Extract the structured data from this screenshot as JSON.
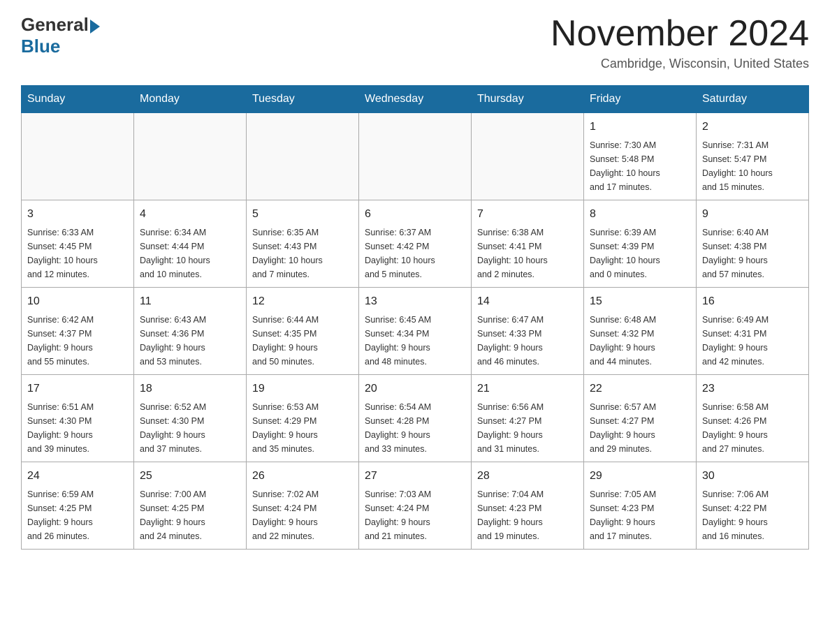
{
  "header": {
    "logo_general": "General",
    "logo_blue": "Blue",
    "title": "November 2024",
    "location": "Cambridge, Wisconsin, United States"
  },
  "days_of_week": [
    "Sunday",
    "Monday",
    "Tuesday",
    "Wednesday",
    "Thursday",
    "Friday",
    "Saturday"
  ],
  "weeks": [
    [
      {
        "day": "",
        "info": ""
      },
      {
        "day": "",
        "info": ""
      },
      {
        "day": "",
        "info": ""
      },
      {
        "day": "",
        "info": ""
      },
      {
        "day": "",
        "info": ""
      },
      {
        "day": "1",
        "info": "Sunrise: 7:30 AM\nSunset: 5:48 PM\nDaylight: 10 hours\nand 17 minutes."
      },
      {
        "day": "2",
        "info": "Sunrise: 7:31 AM\nSunset: 5:47 PM\nDaylight: 10 hours\nand 15 minutes."
      }
    ],
    [
      {
        "day": "3",
        "info": "Sunrise: 6:33 AM\nSunset: 4:45 PM\nDaylight: 10 hours\nand 12 minutes."
      },
      {
        "day": "4",
        "info": "Sunrise: 6:34 AM\nSunset: 4:44 PM\nDaylight: 10 hours\nand 10 minutes."
      },
      {
        "day": "5",
        "info": "Sunrise: 6:35 AM\nSunset: 4:43 PM\nDaylight: 10 hours\nand 7 minutes."
      },
      {
        "day": "6",
        "info": "Sunrise: 6:37 AM\nSunset: 4:42 PM\nDaylight: 10 hours\nand 5 minutes."
      },
      {
        "day": "7",
        "info": "Sunrise: 6:38 AM\nSunset: 4:41 PM\nDaylight: 10 hours\nand 2 minutes."
      },
      {
        "day": "8",
        "info": "Sunrise: 6:39 AM\nSunset: 4:39 PM\nDaylight: 10 hours\nand 0 minutes."
      },
      {
        "day": "9",
        "info": "Sunrise: 6:40 AM\nSunset: 4:38 PM\nDaylight: 9 hours\nand 57 minutes."
      }
    ],
    [
      {
        "day": "10",
        "info": "Sunrise: 6:42 AM\nSunset: 4:37 PM\nDaylight: 9 hours\nand 55 minutes."
      },
      {
        "day": "11",
        "info": "Sunrise: 6:43 AM\nSunset: 4:36 PM\nDaylight: 9 hours\nand 53 minutes."
      },
      {
        "day": "12",
        "info": "Sunrise: 6:44 AM\nSunset: 4:35 PM\nDaylight: 9 hours\nand 50 minutes."
      },
      {
        "day": "13",
        "info": "Sunrise: 6:45 AM\nSunset: 4:34 PM\nDaylight: 9 hours\nand 48 minutes."
      },
      {
        "day": "14",
        "info": "Sunrise: 6:47 AM\nSunset: 4:33 PM\nDaylight: 9 hours\nand 46 minutes."
      },
      {
        "day": "15",
        "info": "Sunrise: 6:48 AM\nSunset: 4:32 PM\nDaylight: 9 hours\nand 44 minutes."
      },
      {
        "day": "16",
        "info": "Sunrise: 6:49 AM\nSunset: 4:31 PM\nDaylight: 9 hours\nand 42 minutes."
      }
    ],
    [
      {
        "day": "17",
        "info": "Sunrise: 6:51 AM\nSunset: 4:30 PM\nDaylight: 9 hours\nand 39 minutes."
      },
      {
        "day": "18",
        "info": "Sunrise: 6:52 AM\nSunset: 4:30 PM\nDaylight: 9 hours\nand 37 minutes."
      },
      {
        "day": "19",
        "info": "Sunrise: 6:53 AM\nSunset: 4:29 PM\nDaylight: 9 hours\nand 35 minutes."
      },
      {
        "day": "20",
        "info": "Sunrise: 6:54 AM\nSunset: 4:28 PM\nDaylight: 9 hours\nand 33 minutes."
      },
      {
        "day": "21",
        "info": "Sunrise: 6:56 AM\nSunset: 4:27 PM\nDaylight: 9 hours\nand 31 minutes."
      },
      {
        "day": "22",
        "info": "Sunrise: 6:57 AM\nSunset: 4:27 PM\nDaylight: 9 hours\nand 29 minutes."
      },
      {
        "day": "23",
        "info": "Sunrise: 6:58 AM\nSunset: 4:26 PM\nDaylight: 9 hours\nand 27 minutes."
      }
    ],
    [
      {
        "day": "24",
        "info": "Sunrise: 6:59 AM\nSunset: 4:25 PM\nDaylight: 9 hours\nand 26 minutes."
      },
      {
        "day": "25",
        "info": "Sunrise: 7:00 AM\nSunset: 4:25 PM\nDaylight: 9 hours\nand 24 minutes."
      },
      {
        "day": "26",
        "info": "Sunrise: 7:02 AM\nSunset: 4:24 PM\nDaylight: 9 hours\nand 22 minutes."
      },
      {
        "day": "27",
        "info": "Sunrise: 7:03 AM\nSunset: 4:24 PM\nDaylight: 9 hours\nand 21 minutes."
      },
      {
        "day": "28",
        "info": "Sunrise: 7:04 AM\nSunset: 4:23 PM\nDaylight: 9 hours\nand 19 minutes."
      },
      {
        "day": "29",
        "info": "Sunrise: 7:05 AM\nSunset: 4:23 PM\nDaylight: 9 hours\nand 17 minutes."
      },
      {
        "day": "30",
        "info": "Sunrise: 7:06 AM\nSunset: 4:22 PM\nDaylight: 9 hours\nand 16 minutes."
      }
    ]
  ]
}
